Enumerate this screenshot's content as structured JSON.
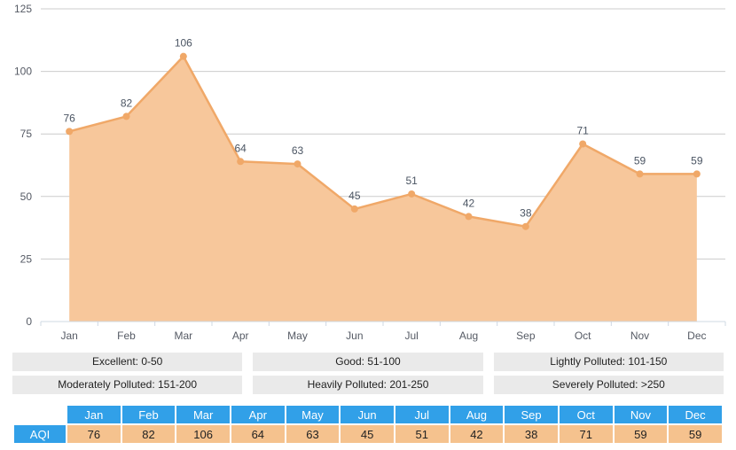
{
  "chart_data": {
    "type": "area",
    "title": "",
    "subtitle": "",
    "xlabel": "",
    "ylabel": "",
    "categories": [
      "Jan",
      "Feb",
      "Mar",
      "Apr",
      "May",
      "Jun",
      "Jul",
      "Aug",
      "Sep",
      "Oct",
      "Nov",
      "Dec"
    ],
    "series": [
      {
        "name": "AQI",
        "values": [
          76,
          82,
          106,
          64,
          63,
          45,
          51,
          42,
          38,
          71,
          59,
          59
        ]
      }
    ],
    "ylim": [
      0,
      125
    ],
    "yticks": [
      0,
      25,
      50,
      75,
      100,
      125
    ],
    "ytick_labels": [
      "0",
      "25",
      "50",
      "75",
      "100",
      "125"
    ],
    "grid": true,
    "legend_position": "below-chart",
    "show_point_labels": true,
    "colors": {
      "area_fill": "#f7c79b",
      "line": "#f0a868",
      "marker": "#f0a868",
      "grid": "#cccccc",
      "axis": "#cfd8e3",
      "tick_text": "#555a64",
      "point_label_text": "#4b5563"
    }
  },
  "legend": {
    "rows": [
      [
        {
          "label": "Excellent: 0-50"
        },
        {
          "label": "Good: 51-100"
        },
        {
          "label": "Lightly Polluted: 101-150"
        }
      ],
      [
        {
          "label": "Moderately Polluted: 151-200"
        },
        {
          "label": "Heavily Polluted: 201-250"
        },
        {
          "label": "Severely Polluted: >250"
        }
      ]
    ],
    "background_color": "#eaeaea"
  },
  "table": {
    "corner_label": "",
    "row_label": "AQI",
    "columns": [
      "Jan",
      "Feb",
      "Mar",
      "Apr",
      "May",
      "Jun",
      "Jul",
      "Aug",
      "Sep",
      "Oct",
      "Nov",
      "Dec"
    ],
    "values": [
      "76",
      "82",
      "106",
      "64",
      "63",
      "45",
      "51",
      "42",
      "38",
      "71",
      "59",
      "59"
    ],
    "header_color": "#31a0e8",
    "value_color": "#f5c28e"
  }
}
